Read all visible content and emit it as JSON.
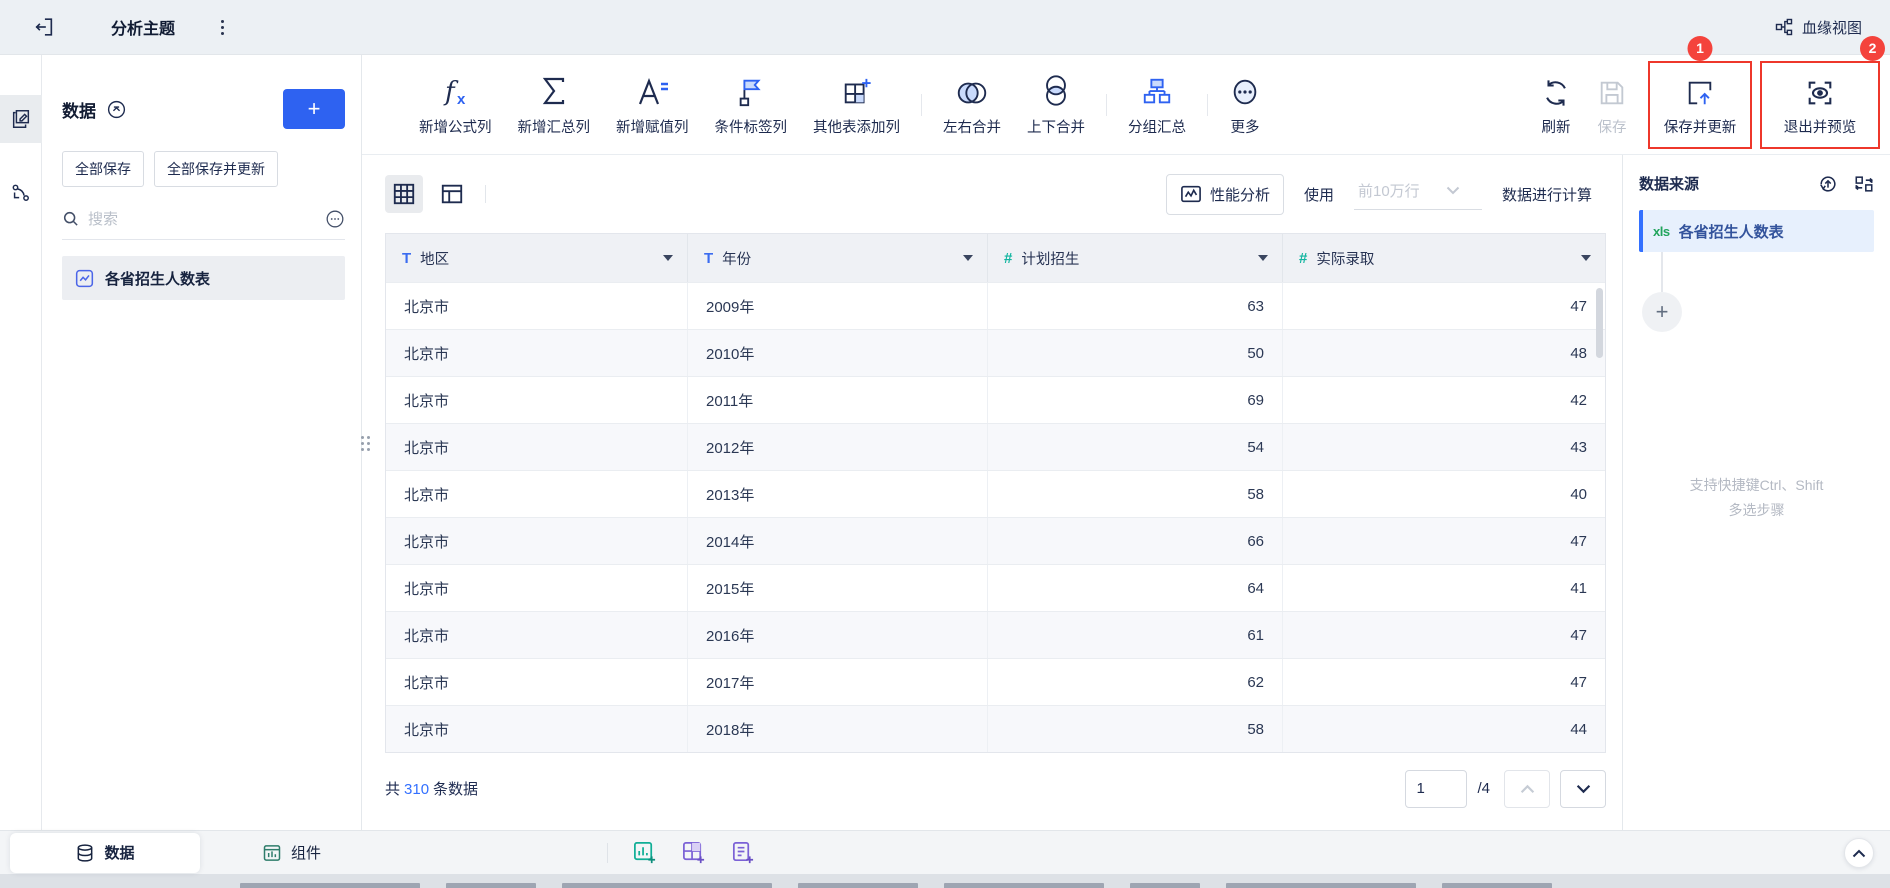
{
  "topbar": {
    "title": "分析主题",
    "lineage": "血缘视图"
  },
  "annotations": {
    "badge1": "1",
    "badge2": "2"
  },
  "sidebar": {
    "title": "数据",
    "save_all": "全部保存",
    "save_all_update": "全部保存并更新",
    "search_placeholder": "搜索",
    "dataset": "各省招生人数表"
  },
  "toolbar": {
    "formula": "新增公式列",
    "aggregate": "新增汇总列",
    "assign": "新增赋值列",
    "condition_tag": "条件标签列",
    "other_table": "其他表添加列",
    "merge_lr": "左右合并",
    "merge_tb": "上下合并",
    "group_summary": "分组汇总",
    "more": "更多",
    "refresh": "刷新",
    "save": "保存",
    "save_update": "保存并更新",
    "exit_preview": "退出并预览"
  },
  "viewbar": {
    "perf": "性能分析",
    "use": "使用",
    "row_limit": "前10万行",
    "calc": "数据进行计算"
  },
  "table": {
    "columns": [
      {
        "label": "地区",
        "type": "text"
      },
      {
        "label": "年份",
        "type": "text"
      },
      {
        "label": "计划招生",
        "type": "number"
      },
      {
        "label": "实际录取",
        "type": "number"
      }
    ],
    "rows": [
      [
        "北京市",
        "2009年",
        "63",
        "47"
      ],
      [
        "北京市",
        "2010年",
        "50",
        "48"
      ],
      [
        "北京市",
        "2011年",
        "69",
        "42"
      ],
      [
        "北京市",
        "2012年",
        "54",
        "43"
      ],
      [
        "北京市",
        "2013年",
        "58",
        "40"
      ],
      [
        "北京市",
        "2014年",
        "66",
        "47"
      ],
      [
        "北京市",
        "2015年",
        "64",
        "41"
      ],
      [
        "北京市",
        "2016年",
        "61",
        "47"
      ],
      [
        "北京市",
        "2017年",
        "62",
        "47"
      ],
      [
        "北京市",
        "2018年",
        "58",
        "44"
      ]
    ]
  },
  "footer": {
    "total_prefix": "共",
    "total": "310",
    "total_suffix": "条数据",
    "page": "1",
    "pages": "/4"
  },
  "datasource": {
    "title": "数据来源",
    "file_type": "xls",
    "step_name": "各省招生人数表",
    "hint1": "支持快捷键Ctrl、Shift",
    "hint2": "多选步骤"
  },
  "bottombar": {
    "tab_data": "数据",
    "tab_component": "组件"
  },
  "colors": {
    "accent": "#2e62f1",
    "teal": "#12b5a0",
    "red": "#ee372b",
    "navy": "#1e2b4f"
  }
}
